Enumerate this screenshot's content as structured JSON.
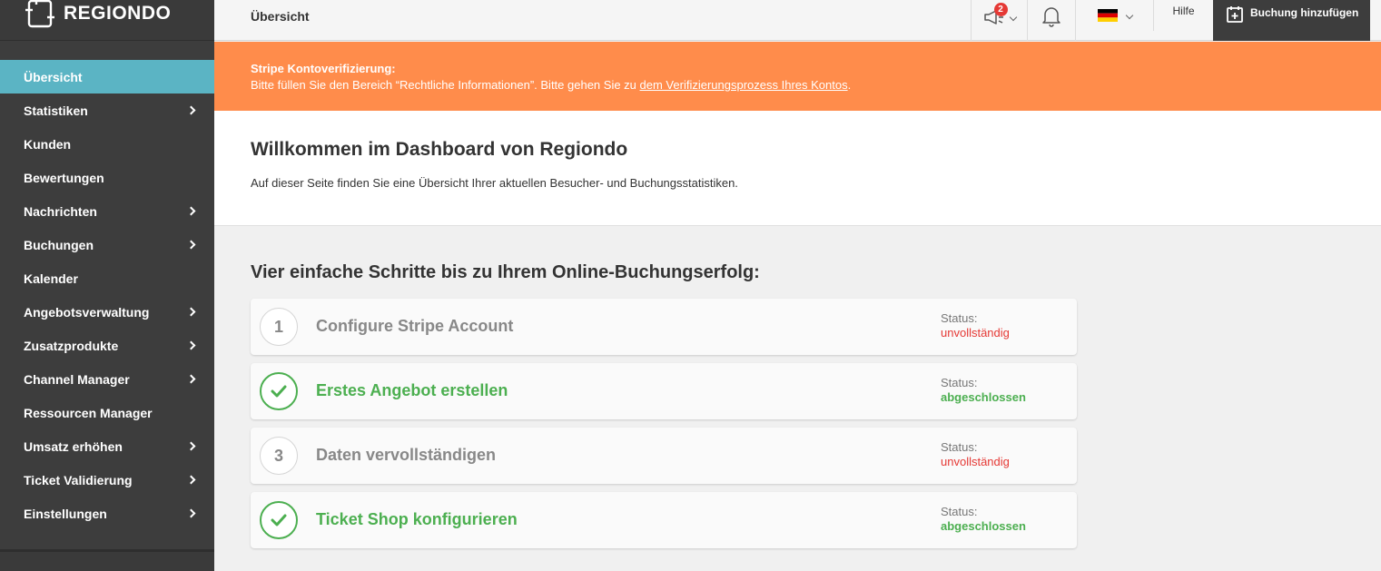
{
  "brand": {
    "name": "REGIONDO"
  },
  "colors": {
    "sidebar": "#3d3d3d",
    "active": "#5bb4c4",
    "banner": "#ff8c4b",
    "success": "#4caf50",
    "danger": "#e53935"
  },
  "sidebar": {
    "items": [
      {
        "label": "Übersicht",
        "active": true,
        "has_submenu": false
      },
      {
        "label": "Statistiken",
        "has_submenu": true
      },
      {
        "label": "Kunden",
        "has_submenu": false
      },
      {
        "label": "Bewertungen",
        "has_submenu": false
      },
      {
        "label": "Nachrichten",
        "has_submenu": true
      },
      {
        "label": "Buchungen",
        "has_submenu": true
      },
      {
        "label": "Kalender",
        "has_submenu": false
      },
      {
        "label": "Angebotsverwaltung",
        "has_submenu": true
      },
      {
        "label": "Zusatzprodukte",
        "has_submenu": true
      },
      {
        "label": "Channel Manager",
        "has_submenu": true
      },
      {
        "label": "Ressourcen Manager",
        "has_submenu": false
      },
      {
        "label": "Umsatz erhöhen",
        "has_submenu": true
      },
      {
        "label": "Ticket Validierung",
        "has_submenu": true
      },
      {
        "label": "Einstellungen",
        "has_submenu": true
      }
    ]
  },
  "topbar": {
    "page_title": "Übersicht",
    "announcement_badge": "2",
    "language_flag": "flag-de-icon",
    "help_label": "Hilfe",
    "add_booking_label": "Buchung hinzufügen"
  },
  "banner": {
    "title": "Stripe Kontoverifizierung:",
    "text": "Bitte füllen Sie den Bereich “Rechtliche Informationen”. Bitte gehen Sie zu ",
    "link": "dem Verifizierungsprozess Ihres Kontos",
    "text_end": "."
  },
  "welcome": {
    "title": "Willkommen im Dashboard von Regiondo",
    "subtitle": "Auf dieser Seite finden Sie eine Übersicht Ihrer aktuellen Besucher- und Buchungsstatistiken."
  },
  "steps": {
    "title": "Vier einfache Schritte bis zu Ihrem Online-Buchungserfolg:",
    "status_label": "Status:",
    "items": [
      {
        "number": "1",
        "label": "Configure Stripe Account",
        "status": "unvollständig",
        "done": false
      },
      {
        "number": "2",
        "label": "Erstes Angebot erstellen",
        "status": "abgeschlossen",
        "done": true
      },
      {
        "number": "3",
        "label": "Daten vervollständigen",
        "status": "unvollständig",
        "done": false
      },
      {
        "number": "4",
        "label": "Ticket Shop konfigurieren",
        "status": "abgeschlossen",
        "done": true
      }
    ]
  }
}
